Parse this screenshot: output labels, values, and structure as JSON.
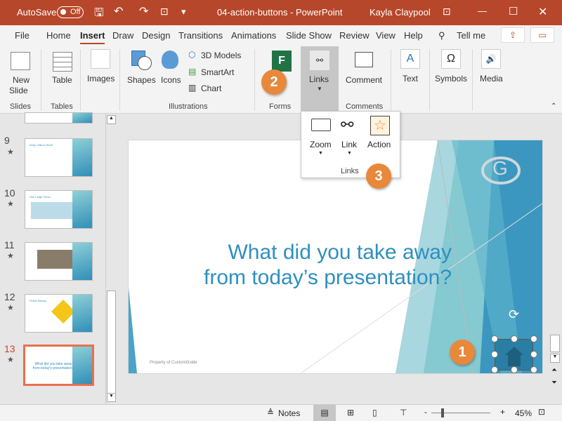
{
  "titlebar": {
    "autosave": "AutoSave",
    "autosave_state": "Off",
    "title": "04-action-buttons  -  PowerPoint",
    "user": "Kayla Claypool"
  },
  "tabs": [
    "File",
    "Home",
    "Insert",
    "Draw",
    "Design",
    "Transitions",
    "Animations",
    "Slide Show",
    "Review",
    "View",
    "Help"
  ],
  "active_tab": "Insert",
  "tell_me": "Tell me",
  "ribbon": {
    "new_slide": "New",
    "new_slide2": "Slide",
    "table": "Table",
    "images": "Images",
    "shapes": "Shapes",
    "icons": "Icons",
    "models": "3D Models",
    "smartart": "SmartArt",
    "chart": "Chart",
    "links": "Links",
    "comment": "Comment",
    "text": "Text",
    "symbols": "Symbols",
    "media": "Media",
    "groups": {
      "slides": "Slides",
      "tables": "Tables",
      "illustrations": "Illustrations",
      "forms": "Forms",
      "comments": "Comments"
    }
  },
  "dropdown": {
    "zoom": "Zoom",
    "link": "Link",
    "action": "Action",
    "group": "Links"
  },
  "callouts": [
    "1",
    "2",
    "3"
  ],
  "slides": [
    {
      "num": "9",
      "title": "Keep Videos Short"
    },
    {
      "num": "10",
      "title": "Use Large Fonts"
    },
    {
      "num": "11",
      "title": ""
    },
    {
      "num": "12",
      "title": "Finish Strong"
    },
    {
      "num": "13",
      "title": "What did you take away from today's presentation?"
    }
  ],
  "current_slide": "13",
  "slide": {
    "line1": "What did you take away",
    "line2": "from today’s presentation?",
    "footer": "Property of CustomGuide"
  },
  "status": {
    "notes": "Notes",
    "zoom": "45%"
  },
  "colors": {
    "titlebar": "#b7472a",
    "accent": "#2e8fbf",
    "callout": "#e8883a",
    "selected": "#e8704f"
  }
}
